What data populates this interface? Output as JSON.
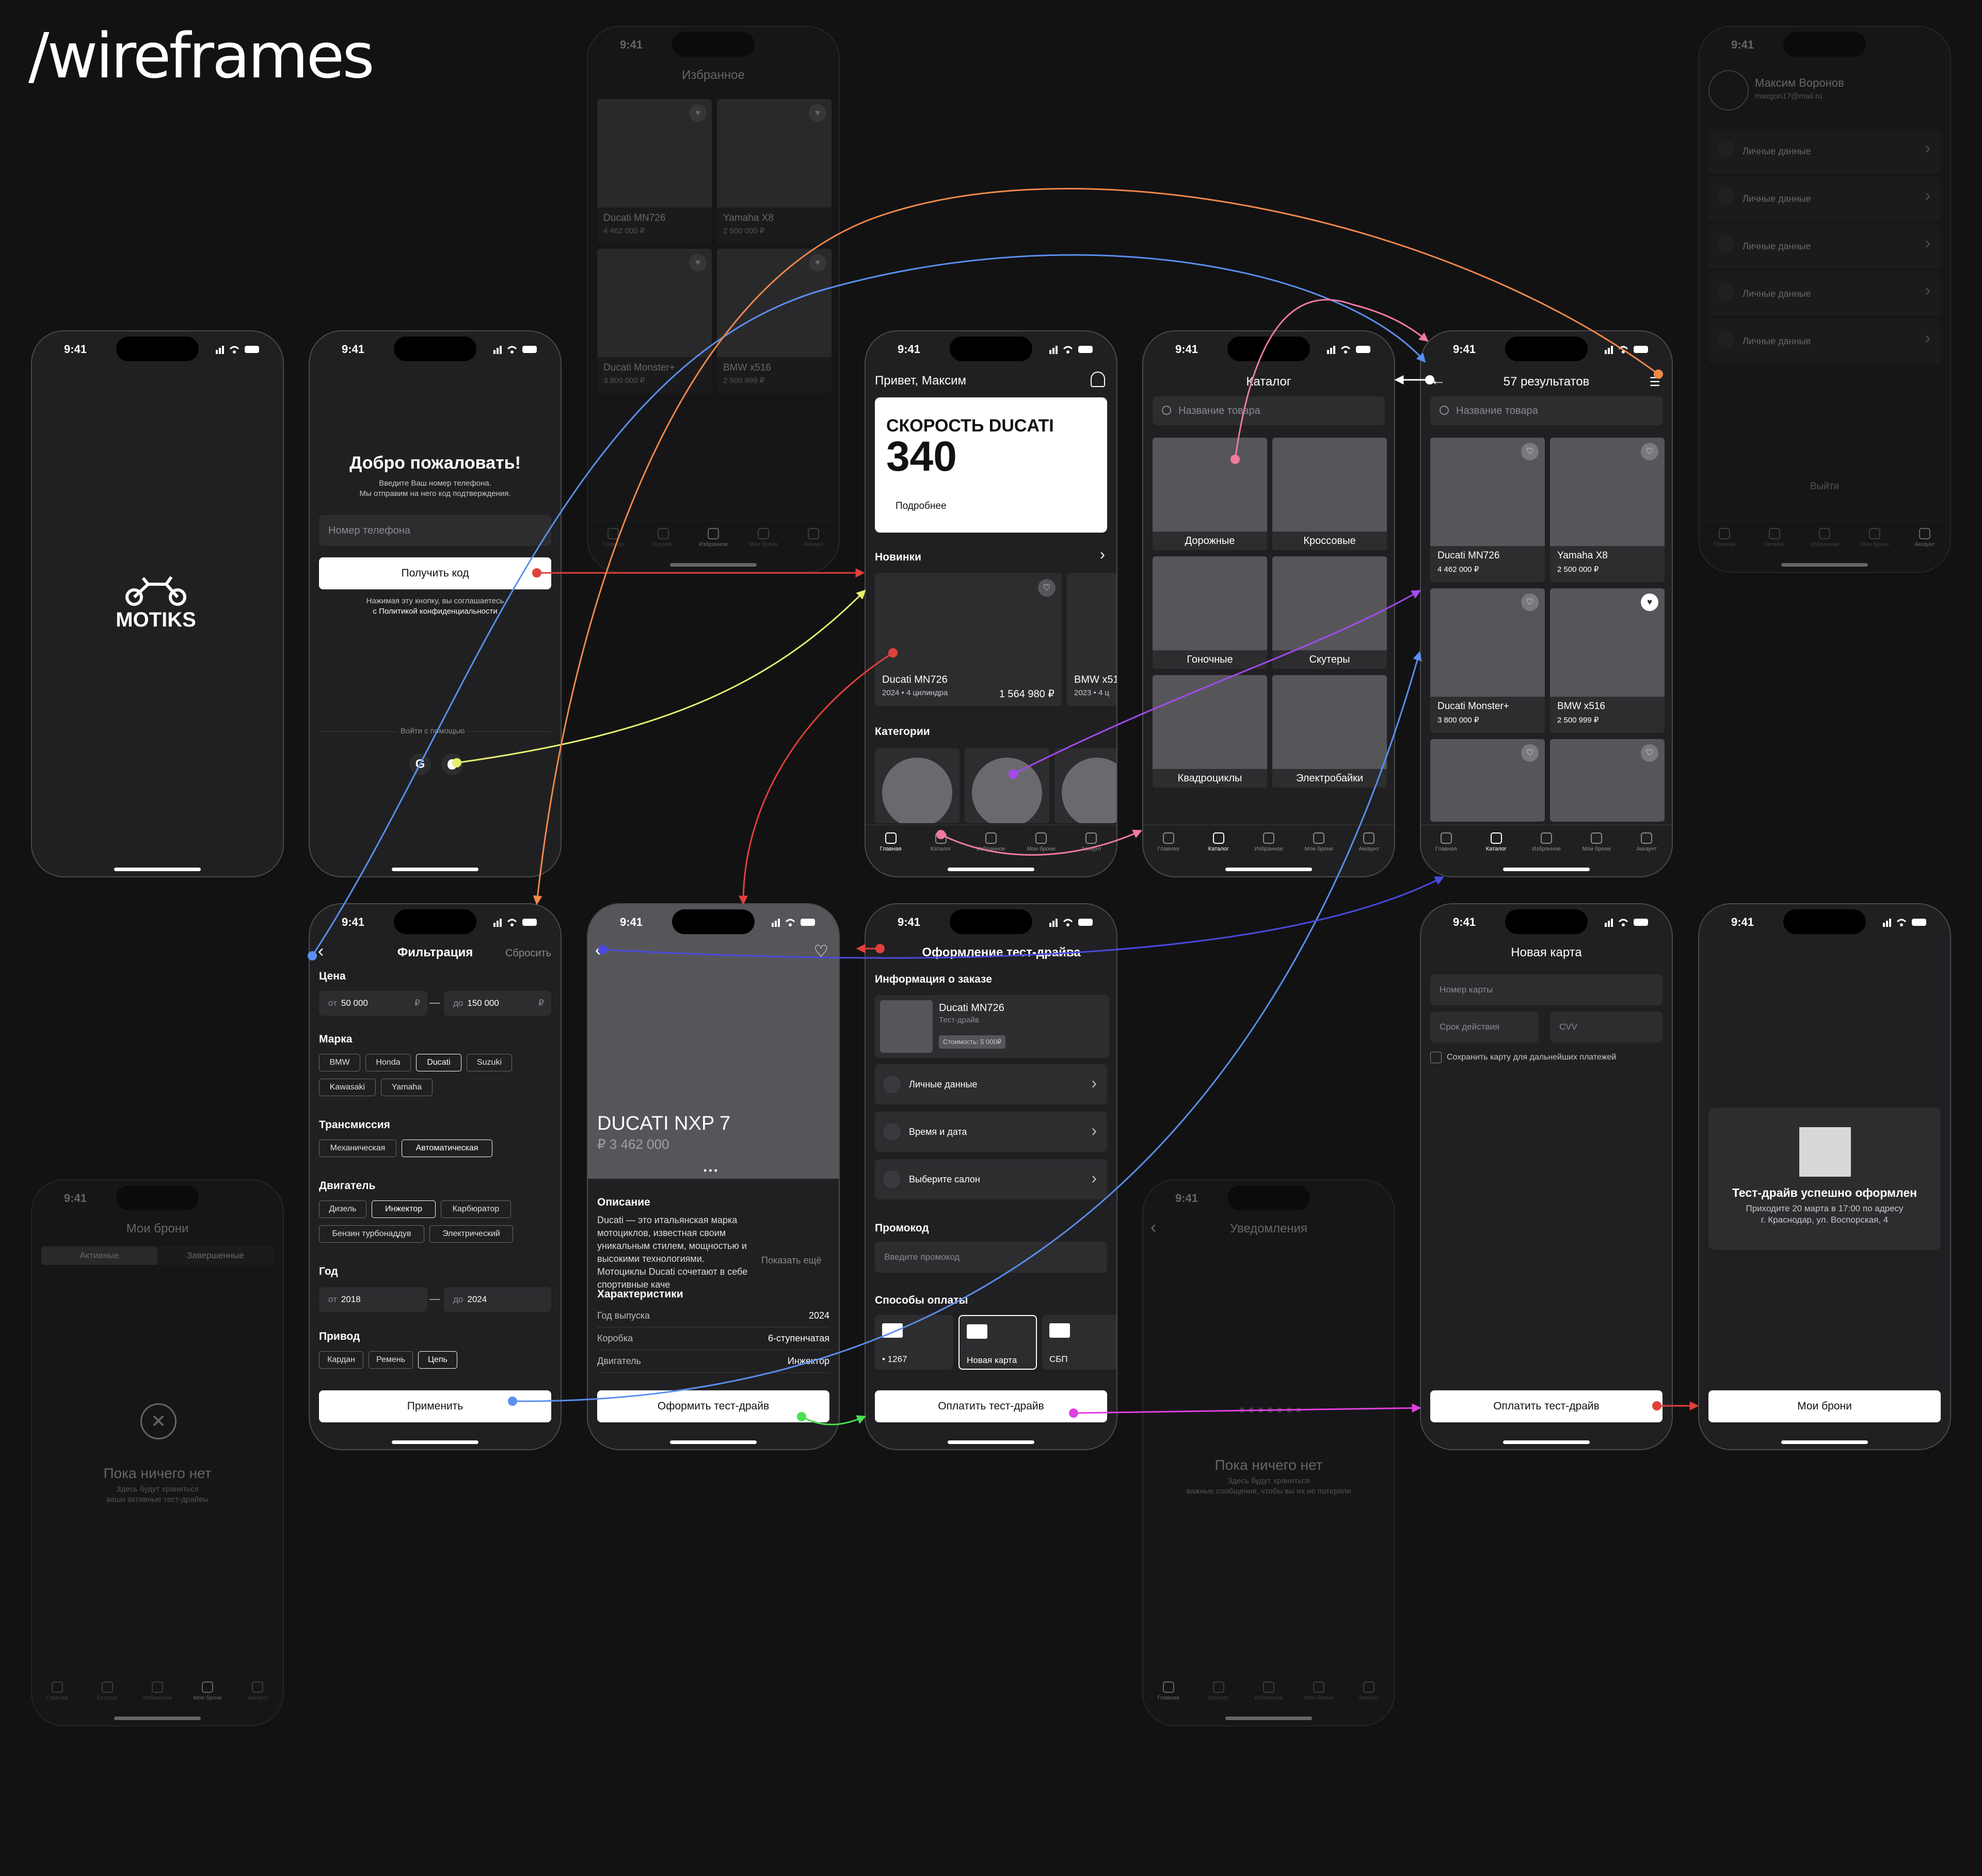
{
  "title": "/wireframes",
  "status_time": "9:41",
  "logo_text": "MOTIKS",
  "login": {
    "heading": "Добро пожаловать!",
    "sub1": "Введите Ваш номер телефона.",
    "sub2": "Мы отправим на него код подтверждения.",
    "phone_placeholder": "Номер телефона",
    "get_code": "Получить код",
    "agree1": "Нажимая эту кнопку, вы соглашаетесь",
    "agree2": "с Политикой конфиденциальности",
    "login_with": "Войти с помощью"
  },
  "favorites": {
    "title": "Избранное",
    "items": [
      {
        "name": "Ducati MN726",
        "price": "4 462 000 ₽"
      },
      {
        "name": "Yamaha X8",
        "price": "2 500 000 ₽"
      },
      {
        "name": "Ducati Monster+",
        "price": "3 800 000 ₽"
      },
      {
        "name": "BMW x516",
        "price": "2 500 999 ₽"
      }
    ]
  },
  "home": {
    "greeting": "Привет, Максим",
    "banner_title": "СКОРОСТЬ DUCATI",
    "banner_value": "340",
    "banner_more": "Подробнее",
    "new_label": "Новинки",
    "card_name": "Ducati MN726",
    "card_meta": "2024 • 4 цилиндра",
    "card_price": "1 564 980 ₽",
    "card2_name": "BMW x51",
    "card2_meta": "2023 • 4 ц",
    "categories_label": "Категории"
  },
  "tabs": [
    "Главная",
    "Каталог",
    "Избранное",
    "Мои брони",
    "Аккаунт"
  ],
  "catalog": {
    "title": "Каталог",
    "search": "Название товара",
    "cats": [
      "Дорожные",
      "Кроссовые",
      "Гоночные",
      "Скутеры",
      "Квадроциклы",
      "Электробайки"
    ]
  },
  "results": {
    "title": "57 результатов",
    "search": "Название товара",
    "items": [
      {
        "name": "Ducati MN726",
        "price": "4 462 000 ₽"
      },
      {
        "name": "Yamaha X8",
        "price": "2 500 000 ₽"
      },
      {
        "name": "Ducati Monster+",
        "price": "3 800 000 ₽"
      },
      {
        "name": "BMW x516",
        "price": "2 500 999 ₽"
      }
    ]
  },
  "account": {
    "name": "Максим Воронов",
    "email": "maxgon17@mail.ru",
    "rows": [
      "Личные данные",
      "Личные данные",
      "Личные данные",
      "Личные данные",
      "Личные данные"
    ],
    "logout": "Выйти"
  },
  "filter": {
    "title": "Фильтрация",
    "reset": "Сбросить",
    "price": "Цена",
    "from_prefix": "от",
    "to_prefix": "до",
    "price_from": "50 000",
    "price_to": "150 000",
    "currency": "₽",
    "brand": "Марка",
    "brands": [
      "BMW",
      "Honda",
      "Ducati",
      "Suzuki",
      "Kawasaki",
      "Yamaha"
    ],
    "transmission": "Трансмиссия",
    "trans": [
      "Механическая",
      "Автоматическая"
    ],
    "engine": "Двигатель",
    "engines": [
      "Дизель",
      "Инжектор",
      "Карбюратор",
      "Бензин турбонаддув",
      "Электрический"
    ],
    "year": "Год",
    "year_from": "2018",
    "year_to": "2024",
    "drive": "Привод",
    "drives": [
      "Кардан",
      "Ремень",
      "Цепь"
    ],
    "apply": "Применить"
  },
  "product": {
    "name": "DUCATI NXP 7",
    "price": "₽ 3 462 000",
    "desc_label": "Описание",
    "desc": "Ducati — это итальянская марка мотоциклов, известная своим уникальным стилем, мощностью и высокими технологиями. Мотоциклы Ducati сочетают в себе спортивные каче",
    "show_more": "Показать ещё",
    "specs_label": "Характеристики",
    "specs": [
      {
        "k": "Год выпуска",
        "v": "2024"
      },
      {
        "k": "Коробка",
        "v": "6-ступенчатая"
      },
      {
        "k": "Двигатель",
        "v": "Инжектор"
      }
    ],
    "cta": "Оформить тест-драйв"
  },
  "checkout": {
    "title": "Оформление тест-драйва",
    "order_info": "Информация о заказе",
    "item": "Ducati MN726",
    "item_sub": "Тест-драйв",
    "item_cost": "Стоимость: 5 000₽",
    "rows": [
      "Личные данные",
      "Время и дата",
      "Выберите салон"
    ],
    "promo": "Промокод",
    "promo_ph": "Введите промокод",
    "pay_label": "Способы оплаты",
    "pay": [
      "• 1267",
      "Новая карта",
      "СБП"
    ],
    "cta": "Оплатить тест-драйв"
  },
  "newcard": {
    "title": "Новая карта",
    "number": "Номер карты",
    "expiry": "Срок действия",
    "cvv": "CVV",
    "save": "Сохранить карту для дальнейших платежей",
    "cta": "Оплатить тест-драйв"
  },
  "success": {
    "title": "Тест-драйв успешно оформлен",
    "line1": "Приходите 20 марта в 17:00 по адресу",
    "line2": "г. Краснодар, ул. Воспорская, 4",
    "cta": "Мои брони"
  },
  "bookings": {
    "title": "Мои брони",
    "seg": [
      "Активные",
      "Завершенные"
    ],
    "empty": "Пока ничего нет",
    "empty_sub1": "Здесь будут храниться",
    "empty_sub2": "ваши активные тест-драйвы"
  },
  "notifications": {
    "title": "Уведомления",
    "empty": "Пока ничего нет",
    "sub1": "Здесь будут храниться",
    "sub2": "важные сообщения, чтобы вы их не потеряли"
  },
  "link_colors": {
    "red": "#e0403a",
    "blue": "#5b8ff0",
    "orange": "#f0884a",
    "yellow": "#e6f06e",
    "violet": "#a64af0",
    "pink": "#f07aa0",
    "magenta": "#e040e0",
    "green": "#4ae050",
    "indigo": "#4a4ae0"
  }
}
